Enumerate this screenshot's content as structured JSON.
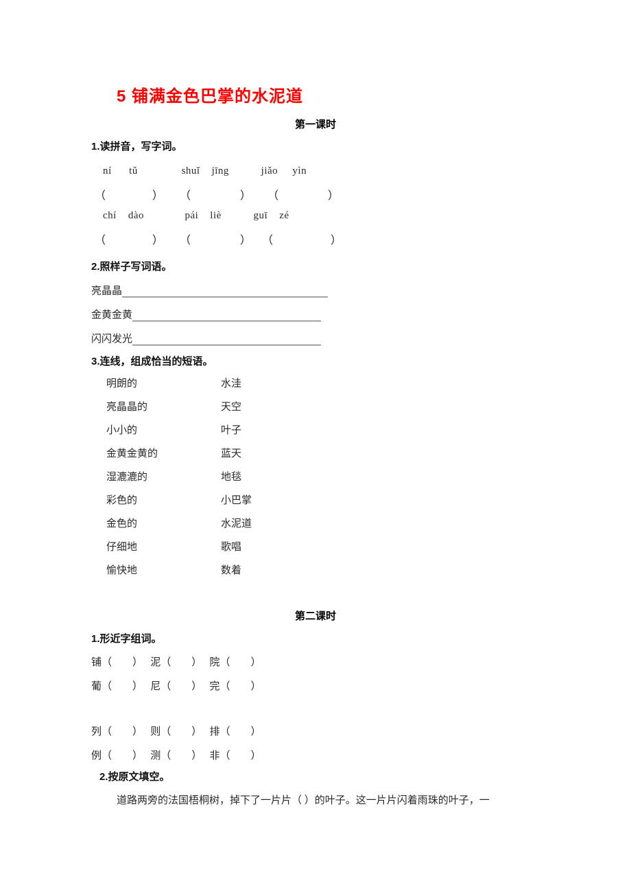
{
  "title": "5 铺满金色巴掌的水泥道",
  "title_color": "#ff0000",
  "periods": {
    "first": "第一课时",
    "second": "第二课时"
  },
  "period_one": {
    "ex1": {
      "heading": "1.读拼音，写字词。",
      "pinyin_rows": [
        "ní      tǔ               shuǐ    jīng           jiǎo     yìn",
        "chí    dào              pái    liè           guī    zé"
      ],
      "paren_rows": [
        "（                 ）      （                  ）      （                  ）",
        "（                 ）      （                  ）    （                     ）"
      ]
    },
    "ex2": {
      "heading": "2.照样子写词语。",
      "items": [
        {
          "word": "亮晶晶",
          "rule_width": 300
        },
        {
          "word": "金黄金黄",
          "rule_width": 275
        },
        {
          "word": "闪闪发光",
          "rule_width": 275
        }
      ]
    },
    "ex3": {
      "heading": "3.连线，组成恰当的短语。",
      "left_column": [
        "明朗的",
        "亮晶晶的",
        "小小的",
        "金黄金黄的",
        "湿漉漉的",
        "彩色的",
        "金色的",
        "仔细地",
        "愉快地"
      ],
      "right_column": [
        "水洼",
        "天空",
        "叶子",
        "蓝天",
        "地毯",
        "小巴掌",
        "水泥道",
        "歌唱",
        "数着"
      ]
    }
  },
  "period_two": {
    "ex1": {
      "heading": "1.形近字组词。",
      "rows": [
        "铺（        ）   泥（        ）   院（        ）",
        "葡（        ）   尼（        ）   完（        ）",
        "列（        ）   则（        ）   排（        ）",
        "例（        ）   测（        ）   非（        ）"
      ]
    },
    "ex2": {
      "heading": "2.按原文填空。",
      "paragraph": "道路两旁的法国梧桐树，掉下了一片片（       ）的叶子。这一片片闪着雨珠的叶子，一"
    }
  }
}
